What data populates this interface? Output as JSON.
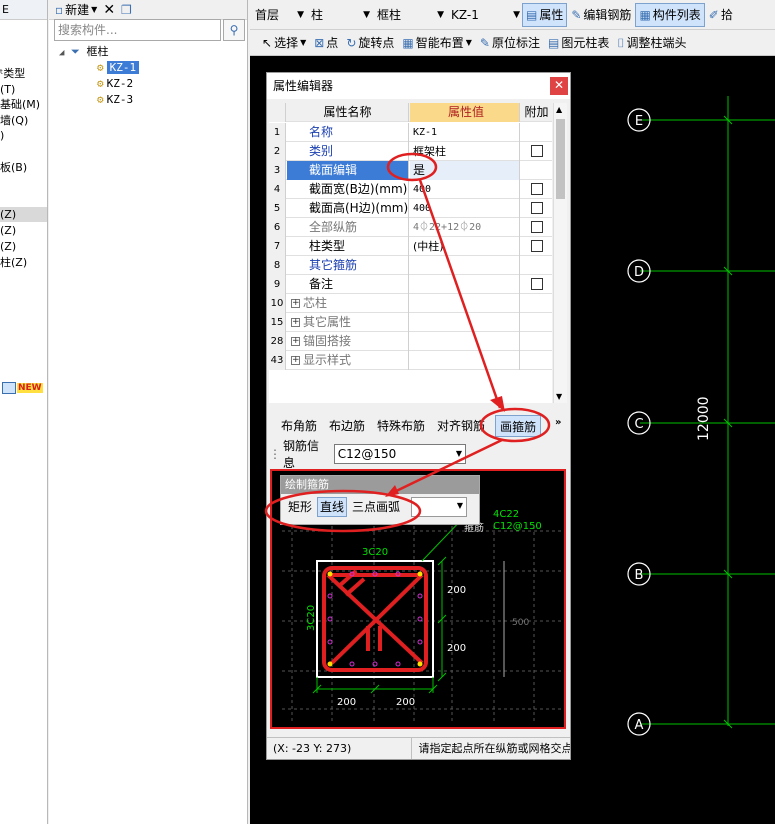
{
  "left_panel": {
    "header": "E",
    "items": [
      "ᵗ类型",
      "(T)",
      "基础(M)",
      "墙(Q)",
      ")",
      "板(B)",
      "(Z)",
      "(Z)",
      "(Z)",
      "柱(Z)"
    ],
    "new_badge": "NEW"
  },
  "tree_panel": {
    "new_label": "新建",
    "search_placeholder": "搜索构件...",
    "root": "框柱",
    "children": [
      "KZ-1",
      "KZ-2",
      "KZ-3"
    ]
  },
  "toolbar1": {
    "floor": "首层",
    "category": "柱",
    "type": "框柱",
    "component": "KZ-1",
    "properties": "属性",
    "edit_rebar": "编辑钢筋",
    "component_list": "构件列表",
    "pick": "拾"
  },
  "toolbar2": {
    "select": "选择",
    "point": "点",
    "rotate_point": "旋转点",
    "smart_layout": "智能布置",
    "origin_mark": "原位标注",
    "column_table": "图元柱表",
    "adjust_column_end": "调整柱端头"
  },
  "cad": {
    "axes": [
      "E",
      "D",
      "C",
      "B",
      "A"
    ],
    "dimension": "12000",
    "accent": "#00c000"
  },
  "property_editor": {
    "title": "属性编辑器",
    "headers": {
      "name": "属性名称",
      "value": "属性值",
      "extra": "附加"
    },
    "rows": [
      {
        "num": "1",
        "name": "名称",
        "value": "KZ-1"
      },
      {
        "num": "2",
        "name": "类别",
        "value": "框架柱"
      },
      {
        "num": "3",
        "name": "截面编辑",
        "value": "是"
      },
      {
        "num": "4",
        "name": "截面宽(B边)(mm)",
        "value": "400"
      },
      {
        "num": "5",
        "name": "截面高(H边)(mm)",
        "value": "400"
      },
      {
        "num": "6",
        "name": "全部纵筋",
        "value": "4⏀22+12⏀20"
      },
      {
        "num": "7",
        "name": "柱类型",
        "value": "(中柱)"
      },
      {
        "num": "8",
        "name": "其它箍筋",
        "value": ""
      },
      {
        "num": "9",
        "name": "备注",
        "value": ""
      },
      {
        "num": "10",
        "name": "芯柱",
        "value": ""
      },
      {
        "num": "15",
        "name": "其它属性",
        "value": ""
      },
      {
        "num": "28",
        "name": "锚固搭接",
        "value": ""
      },
      {
        "num": "43",
        "name": "显示样式",
        "value": ""
      }
    ],
    "tabs": [
      "布角筋",
      "布边筋",
      "特殊布筋",
      "对齐钢筋",
      "画箍筋"
    ],
    "rebar_info_label": "钢筋信息",
    "rebar_info_value": "C12@150",
    "draw_stirrup": {
      "title": "绘制箍筋",
      "buttons": [
        "矩形",
        "直线",
        "三点画弧"
      ],
      "label_corner": "4C22",
      "label_stirrup": "C12@150",
      "label_hoop": "箍筋",
      "top_bars": "3C20",
      "left_bars": "3C20",
      "dim_right_1": "200",
      "dim_right_2": "200",
      "dim_bottom_1": "200",
      "dim_bottom_2": "200",
      "dim_faint": "500"
    },
    "status": "(X: -23 Y: 273)",
    "status_hint": "请指定起点所在纵筋或网格交点"
  }
}
